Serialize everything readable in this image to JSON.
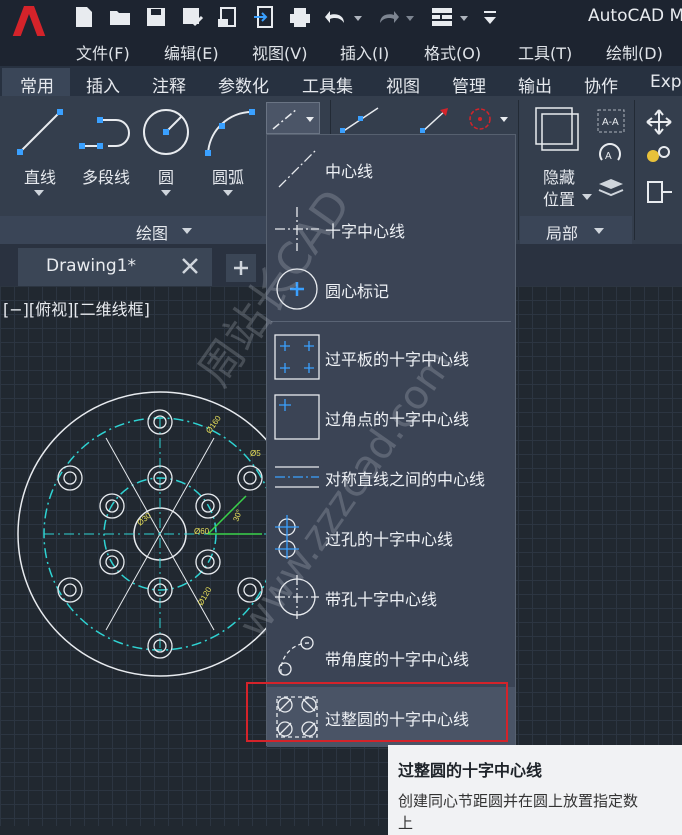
{
  "app": {
    "title": "AutoCAD M"
  },
  "menus": [
    {
      "label": "文件(F)"
    },
    {
      "label": "编辑(E)"
    },
    {
      "label": "视图(V)"
    },
    {
      "label": "插入(I)"
    },
    {
      "label": "格式(O)"
    },
    {
      "label": "工具(T)"
    },
    {
      "label": "绘制(D)"
    }
  ],
  "ribbon_tabs": [
    {
      "label": "常用"
    },
    {
      "label": "插入"
    },
    {
      "label": "注释"
    },
    {
      "label": "参数化"
    },
    {
      "label": "工具集"
    },
    {
      "label": "视图"
    },
    {
      "label": "管理"
    },
    {
      "label": "输出"
    },
    {
      "label": "协作"
    },
    {
      "label": "Exp"
    }
  ],
  "draw_panel": {
    "title": "绘图",
    "tools": [
      {
        "label": "直线"
      },
      {
        "label": "多段线"
      },
      {
        "label": "圆"
      },
      {
        "label": "圆弧"
      }
    ]
  },
  "local_panel": {
    "title": "局部",
    "hide_label": "隐藏",
    "position_label": "位置"
  },
  "document": {
    "tab_title": "Drawing1*",
    "view_label": "[−][俯视][二维线框]"
  },
  "drawing_dims": [
    "Ø160",
    "Ø5",
    "30°",
    "Ø60",
    "Ø30",
    "Ø120"
  ],
  "dropdown": {
    "items": [
      {
        "label": "中心线",
        "icon": "centerline-icon"
      },
      {
        "label": "十字中心线",
        "icon": "cross-centerline-icon"
      },
      {
        "label": "圆心标记",
        "icon": "center-mark-icon"
      },
      {
        "label": "过平板的十字中心线",
        "icon": "plate-cross-centerline-icon"
      },
      {
        "label": "过角点的十字中心线",
        "icon": "corner-cross-centerline-icon"
      },
      {
        "label": "对称直线之间的中心线",
        "icon": "symmetric-lines-centerline-icon"
      },
      {
        "label": "过孔的十字中心线",
        "icon": "hole-cross-centerline-icon"
      },
      {
        "label": "带孔十字中心线",
        "icon": "cross-with-hole-icon"
      },
      {
        "label": "带角度的十字中心线",
        "icon": "angled-cross-centerline-icon"
      },
      {
        "label": "过整圆的十字中心线",
        "icon": "full-circle-cross-centerline-icon"
      }
    ]
  },
  "tooltip": {
    "title": "过整圆的十字中心线",
    "description": "创建同心节距圆并在圆上放置指定数",
    "description_cont": "上"
  },
  "watermark": {
    "text1": "周站长CAD",
    "text2": "www.zzzcad.com"
  },
  "colors": {
    "accent_red": "#d4232a",
    "cyan": "#2fd3d3",
    "yellow": "#e8e05a",
    "green": "#3ad24a"
  }
}
